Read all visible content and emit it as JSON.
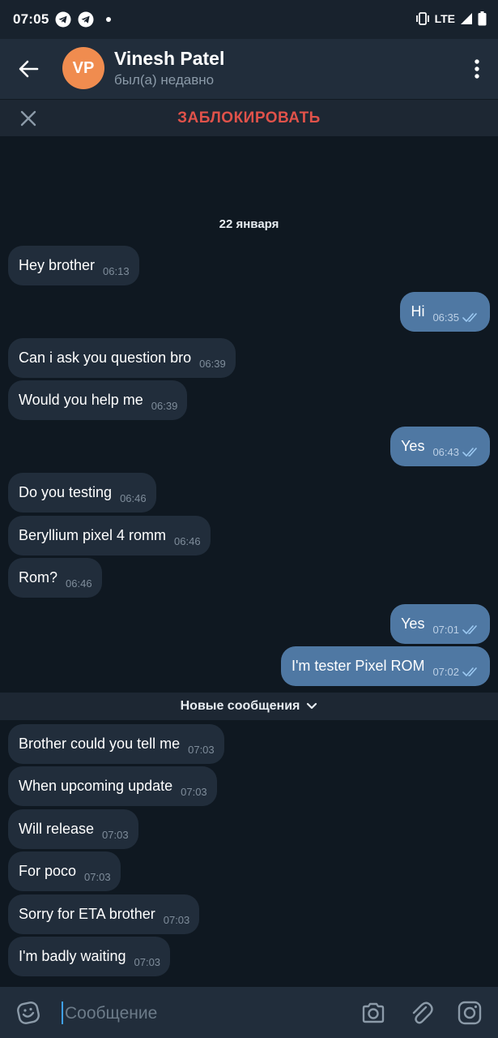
{
  "status_bar": {
    "time": "07:05",
    "network": "LTE",
    "icons": [
      "telegram-icon",
      "telegram-icon",
      "dot-icon",
      "vibrate-icon",
      "signal-icon",
      "battery-icon"
    ]
  },
  "header": {
    "avatar_initials": "VP",
    "avatar_color": "#f08c4f",
    "name": "Vinesh Patel",
    "status": "был(а) недавно"
  },
  "action_bar": {
    "block_label": "ЗАБЛОКИРОВАТЬ",
    "block_color": "#e0524a"
  },
  "chat": {
    "date": "22 января",
    "new_messages_label": "Новые сообщения",
    "messages": [
      {
        "dir": "in",
        "text": "Hey brother",
        "time": "06:13"
      },
      {
        "dir": "out",
        "text": "Hi",
        "time": "06:35"
      },
      {
        "dir": "in",
        "text": "Can i ask you question bro",
        "time": "06:39"
      },
      {
        "dir": "in",
        "text": "Would you help me",
        "time": "06:39"
      },
      {
        "dir": "out",
        "text": "Yes",
        "time": "06:43"
      },
      {
        "dir": "in",
        "text": "Do you testing",
        "time": "06:46"
      },
      {
        "dir": "in",
        "text": "Beryllium pixel 4 romm",
        "time": "06:46"
      },
      {
        "dir": "in",
        "text": "Rom?",
        "time": "06:46"
      },
      {
        "dir": "out",
        "text": "Yes",
        "time": "07:01"
      },
      {
        "dir": "out",
        "text": "I'm tester Pixel ROM",
        "time": "07:02"
      },
      {
        "dir": "in",
        "text": "Brother could you tell me",
        "time": "07:03"
      },
      {
        "dir": "in",
        "text": "When upcoming update",
        "time": "07:03"
      },
      {
        "dir": "in",
        "text": "Will release",
        "time": "07:03"
      },
      {
        "dir": "in",
        "text": "For poco",
        "time": "07:03"
      },
      {
        "dir": "in",
        "text": "Sorry for ETA brother",
        "time": "07:03"
      },
      {
        "dir": "in",
        "text": "I'm badly waiting",
        "time": "07:03"
      }
    ]
  },
  "input": {
    "placeholder": "Сообщение"
  },
  "colors": {
    "incoming_bubble": "#212d3b",
    "outgoing_bubble": "#4f78a3",
    "chat_background": "#0f1821",
    "read_ticks": "#6fb3ef"
  }
}
